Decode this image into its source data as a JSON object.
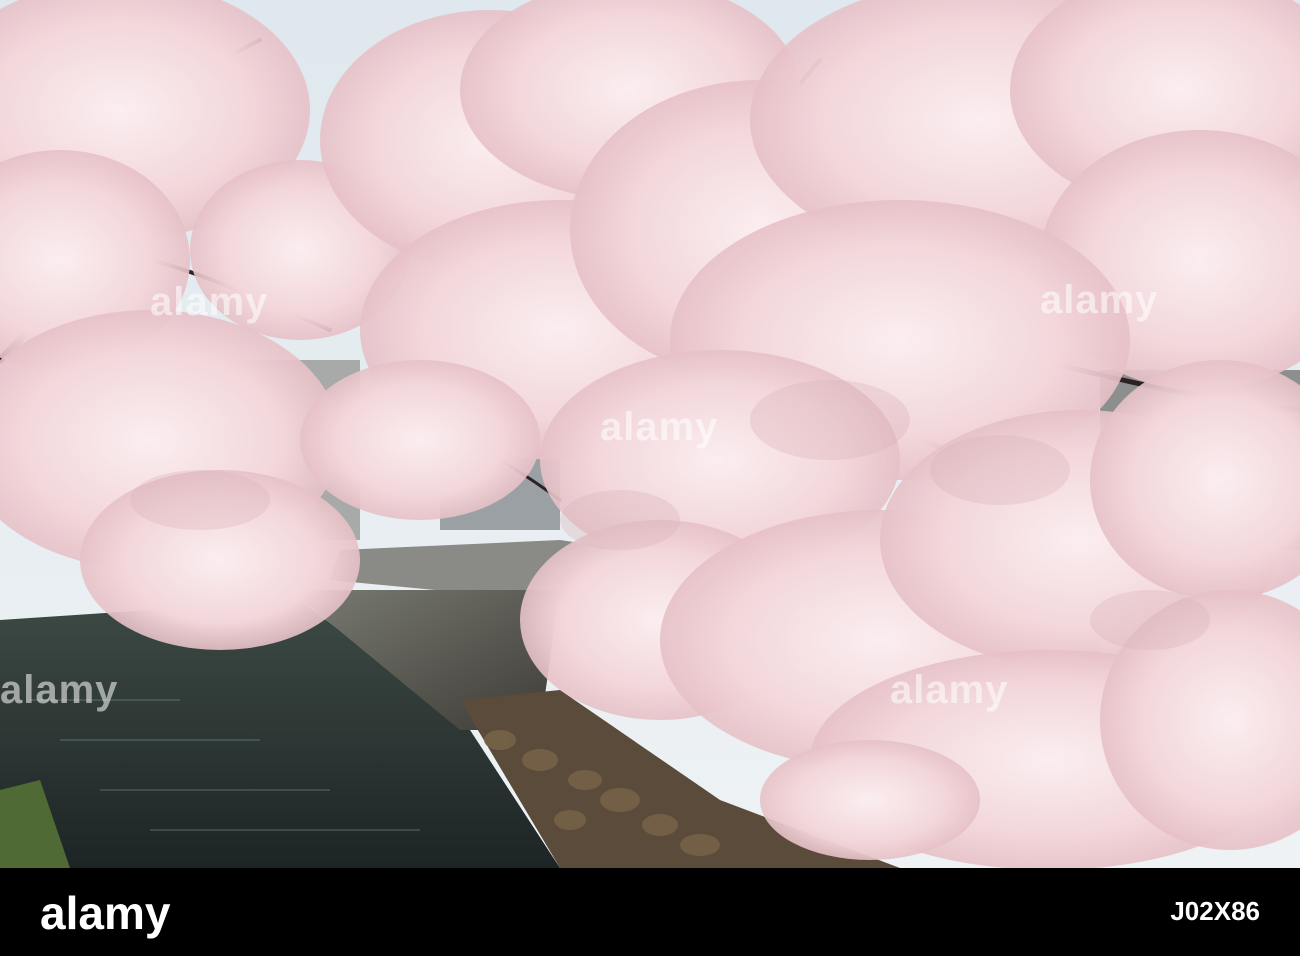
{
  "photo": {
    "subject": "",
    "colors": {
      "sky": "#e4ecf2",
      "blossom": "#f6dde0",
      "blossom_shade": "#e7c3c9",
      "water": "#2a3536",
      "wall": "#5f5f58",
      "branch": "#2c2225"
    }
  },
  "watermark": {
    "brand": "alamy",
    "image_id": "J02X86"
  },
  "footer": {
    "brand": "alamy",
    "image_id": "J02X86"
  }
}
